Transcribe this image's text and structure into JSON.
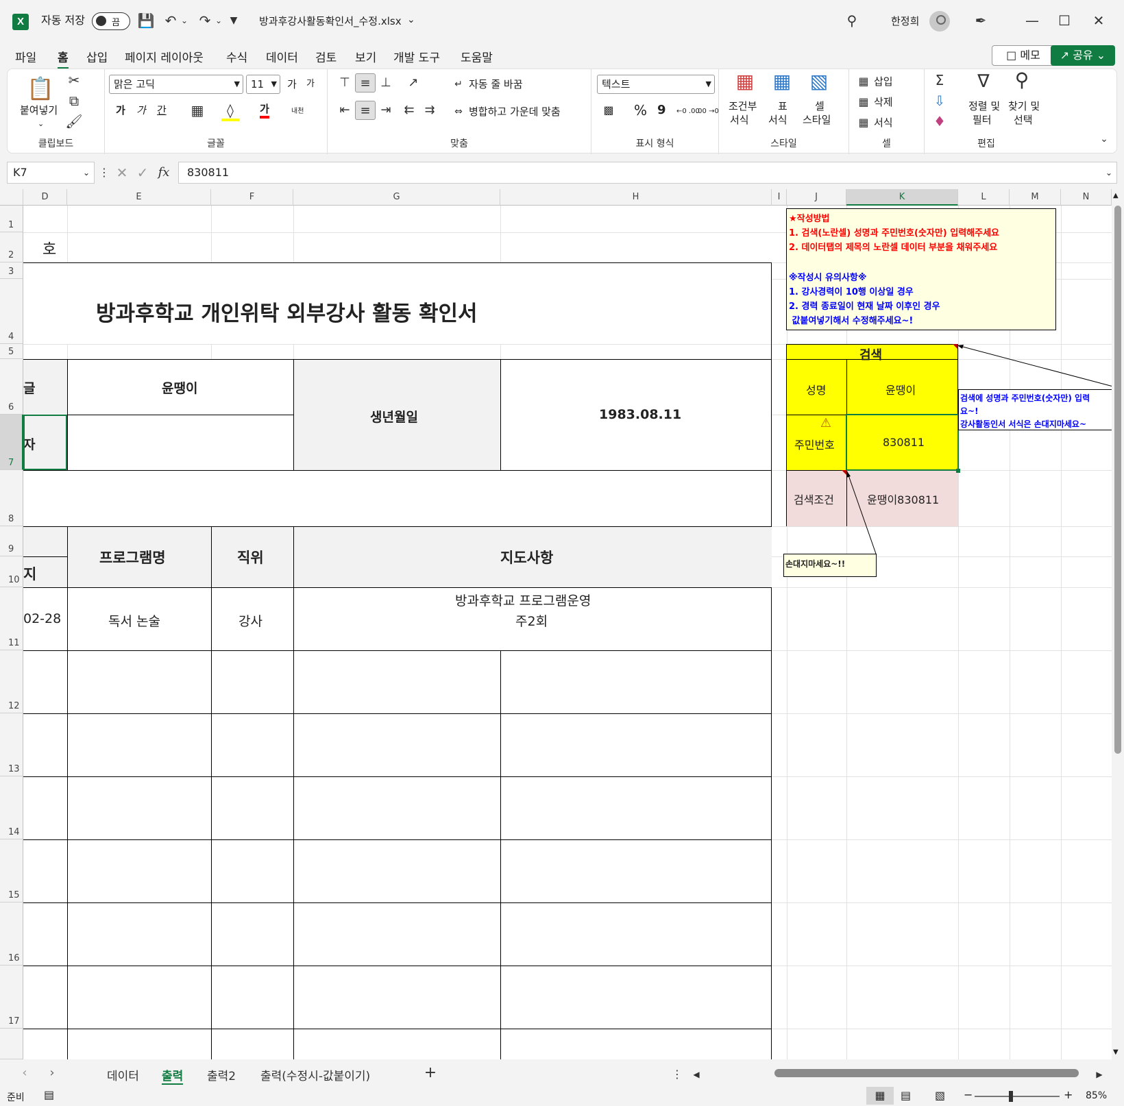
{
  "titlebar": {
    "app_icon": "X",
    "autosave_label": "자동 저장",
    "autosave_state": "끔",
    "filename": "방과후강사활동확인서_수정.xlsx",
    "filename_chevron": "⌄",
    "user_name": "한정희"
  },
  "menu": {
    "tabs": [
      "파일",
      "홈",
      "삽입",
      "페이지 레이아웃",
      "수식",
      "데이터",
      "검토",
      "보기",
      "개발 도구",
      "도움말"
    ],
    "active": "홈",
    "memo_label": "메모",
    "share_label": "공유"
  },
  "ribbon": {
    "clipboard": {
      "paste": "붙여넣기",
      "label": "클립보드"
    },
    "font": {
      "name": "맑은 고딕",
      "size": "11",
      "bold": "가",
      "italic": "가",
      "underline": "간",
      "grow": "가",
      "shrink": "가",
      "fontcolor": "가",
      "phonetic": "내천",
      "label": "글꼴"
    },
    "align": {
      "wrap": "자동 줄 바꿈",
      "merge": "병합하고 가운데 맞춤",
      "label": "맞춤"
    },
    "number": {
      "format": "텍스트",
      "percent": "%",
      "comma": "9",
      "inc_decimal": "←0 .00",
      "dec_decimal": ".00 →0",
      "label": "표시 형식"
    },
    "styles": {
      "conditional": "조건부",
      "conditional2": "서식",
      "table": "표",
      "table2": "서식",
      "cell": "셀",
      "cell2": "스타일",
      "label": "스타일"
    },
    "cells": {
      "insert": "삽입",
      "delete": "삭제",
      "format": "서식",
      "label": "셀"
    },
    "editing": {
      "sort": "정렬 및",
      "sort2": "필터",
      "find": "찾기 및",
      "find2": "선택",
      "label": "편집"
    }
  },
  "formula_bar": {
    "name_box": "K7",
    "fx": "fx",
    "value": "830811"
  },
  "columns": [
    "D",
    "E",
    "F",
    "G",
    "H",
    "I",
    "J",
    "K",
    "L",
    "M",
    "N"
  ],
  "rows": [
    "1",
    "2",
    "3",
    "4",
    "5",
    "6",
    "7",
    "8",
    "9",
    "10",
    "11",
    "12",
    "13",
    "14",
    "15",
    "16",
    "17"
  ],
  "sheet": {
    "ho": "호",
    "doc_title": "방과후학교 개인위탁 외부강사 활동 확인서",
    "left_cut_1": "글",
    "left_cut_2": "자",
    "name_value": "윤땡이",
    "birth_label": "생년월일",
    "birth_value": "1983.08.11",
    "hdr_left_cut": "지",
    "hdr_program": "프로그램명",
    "hdr_position": "직위",
    "hdr_guidance": "지도사항",
    "row11_date_cut": "02-28",
    "row11_program": "독서 논술",
    "row11_position": "강사",
    "row11_guidance_1": "방과후학교 프로그램운영",
    "row11_guidance_2": "주2회"
  },
  "instructions": {
    "title": "★작성방법",
    "line1": "1. 검색(노란셀) 성명과 주민번호(숫자만) 입력해주세요",
    "line2": "2. 데이터탭의 제목의 노란셀 데이터 부분을 채워주세요",
    "note_title": "※작성시 유의사항※",
    "note1": "1. 강사경력이 10행 이상일 경우",
    "note2": "2. 경력 종료일이 현재 날짜 이후인 경우",
    "note3": " 값붙여넣기해서 수정해주세요~!"
  },
  "search_box": {
    "title": "검색",
    "name_label": "성명",
    "name_value": "윤땡이",
    "id_label": "주민번호",
    "id_value": "830811",
    "cond_label": "검색조건",
    "cond_value": "윤땡이830811"
  },
  "comment_right": {
    "line1": "검색에 성명과 주민번호(숫자만) 입력",
    "line2": "요~!",
    "line3": "강사활동인서 서식은 손대지마세요~"
  },
  "comment_bottom": "손대지마세요~!!",
  "sheet_tabs": [
    "데이터",
    "출력",
    "출력2",
    "출력(수정시-값붙이기)"
  ],
  "active_sheet": "출력",
  "status": {
    "ready": "준비",
    "zoom": "85%"
  },
  "colors": {
    "excel_green": "#107c41",
    "yellow_cell": "#ffff00",
    "pink_cell": "#f2dcdb",
    "instruction_bg": "#ffffe1",
    "red_text": "#ff0000",
    "blue_text": "#0000ff"
  }
}
